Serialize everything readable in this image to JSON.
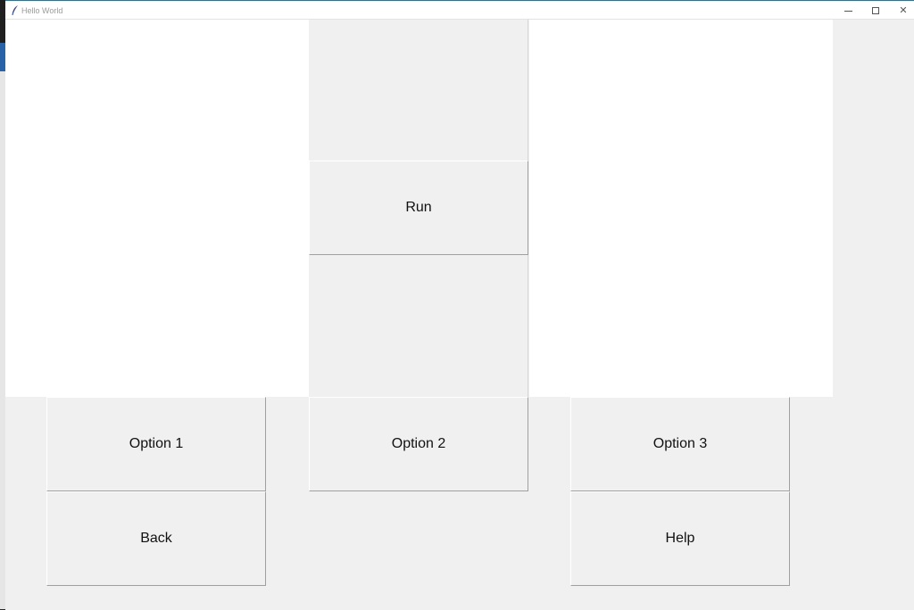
{
  "window": {
    "title": "Hello World",
    "app_icon": "feather-icon",
    "controls": {
      "minimize_icon": "minimize-icon",
      "maximize_icon": "maximize-icon",
      "close_icon": "close-icon",
      "close_glyph": "✕"
    }
  },
  "buttons": {
    "run": "Run",
    "option1": "Option 1",
    "option2": "Option 2",
    "option3": "Option 3",
    "back": "Back",
    "help": "Help"
  },
  "colors": {
    "window_bg": "#f0f0f0",
    "panel_bg": "#ffffff",
    "accent": "#2a62a8"
  }
}
